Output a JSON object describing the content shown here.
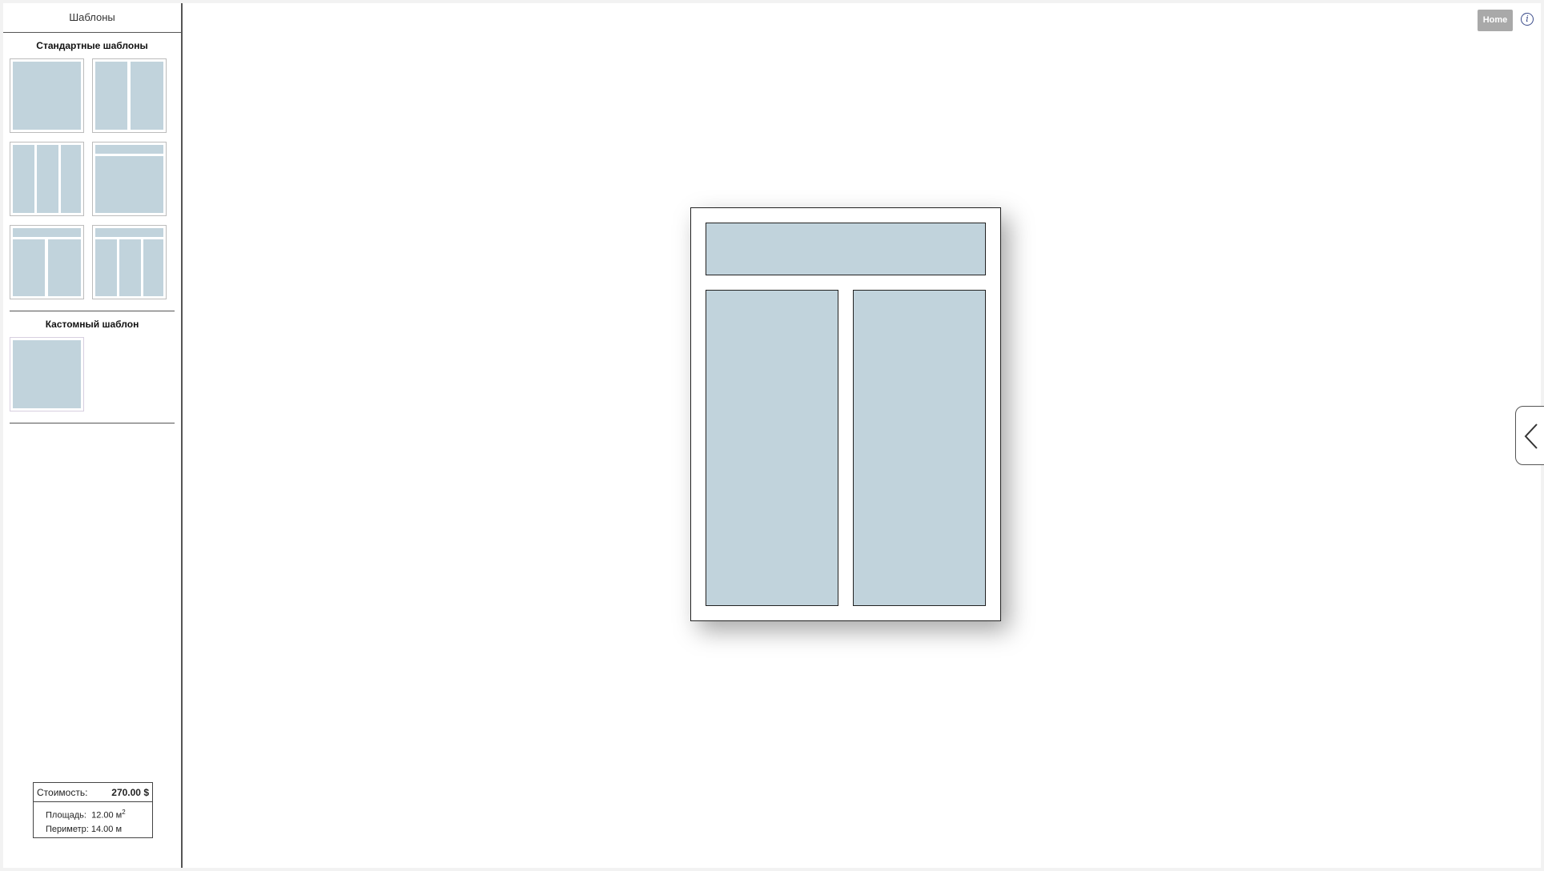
{
  "sidebar": {
    "title": "Шаблоны",
    "standard_label": "Стандартные шаблоны",
    "custom_label": "Кастомный шаблон"
  },
  "summary": {
    "cost_label": "Стоимость:",
    "cost_value": "270.00 $",
    "area_label": "Площадь:",
    "area_value": "12.00 м",
    "area_unit_exp": "2",
    "perimeter_label": "Периметр:",
    "perimeter_value": "14.00 м"
  },
  "toolbar": {
    "home_label": "Home",
    "info_icon": "i"
  },
  "icons": {
    "info": "info-icon",
    "collapse": "chevron-left-icon"
  },
  "colors": {
    "glass": "#c1d3dc",
    "frame_border": "#222222",
    "home_button": "#a9a9a9",
    "info_icon": "#3a4b8a"
  }
}
